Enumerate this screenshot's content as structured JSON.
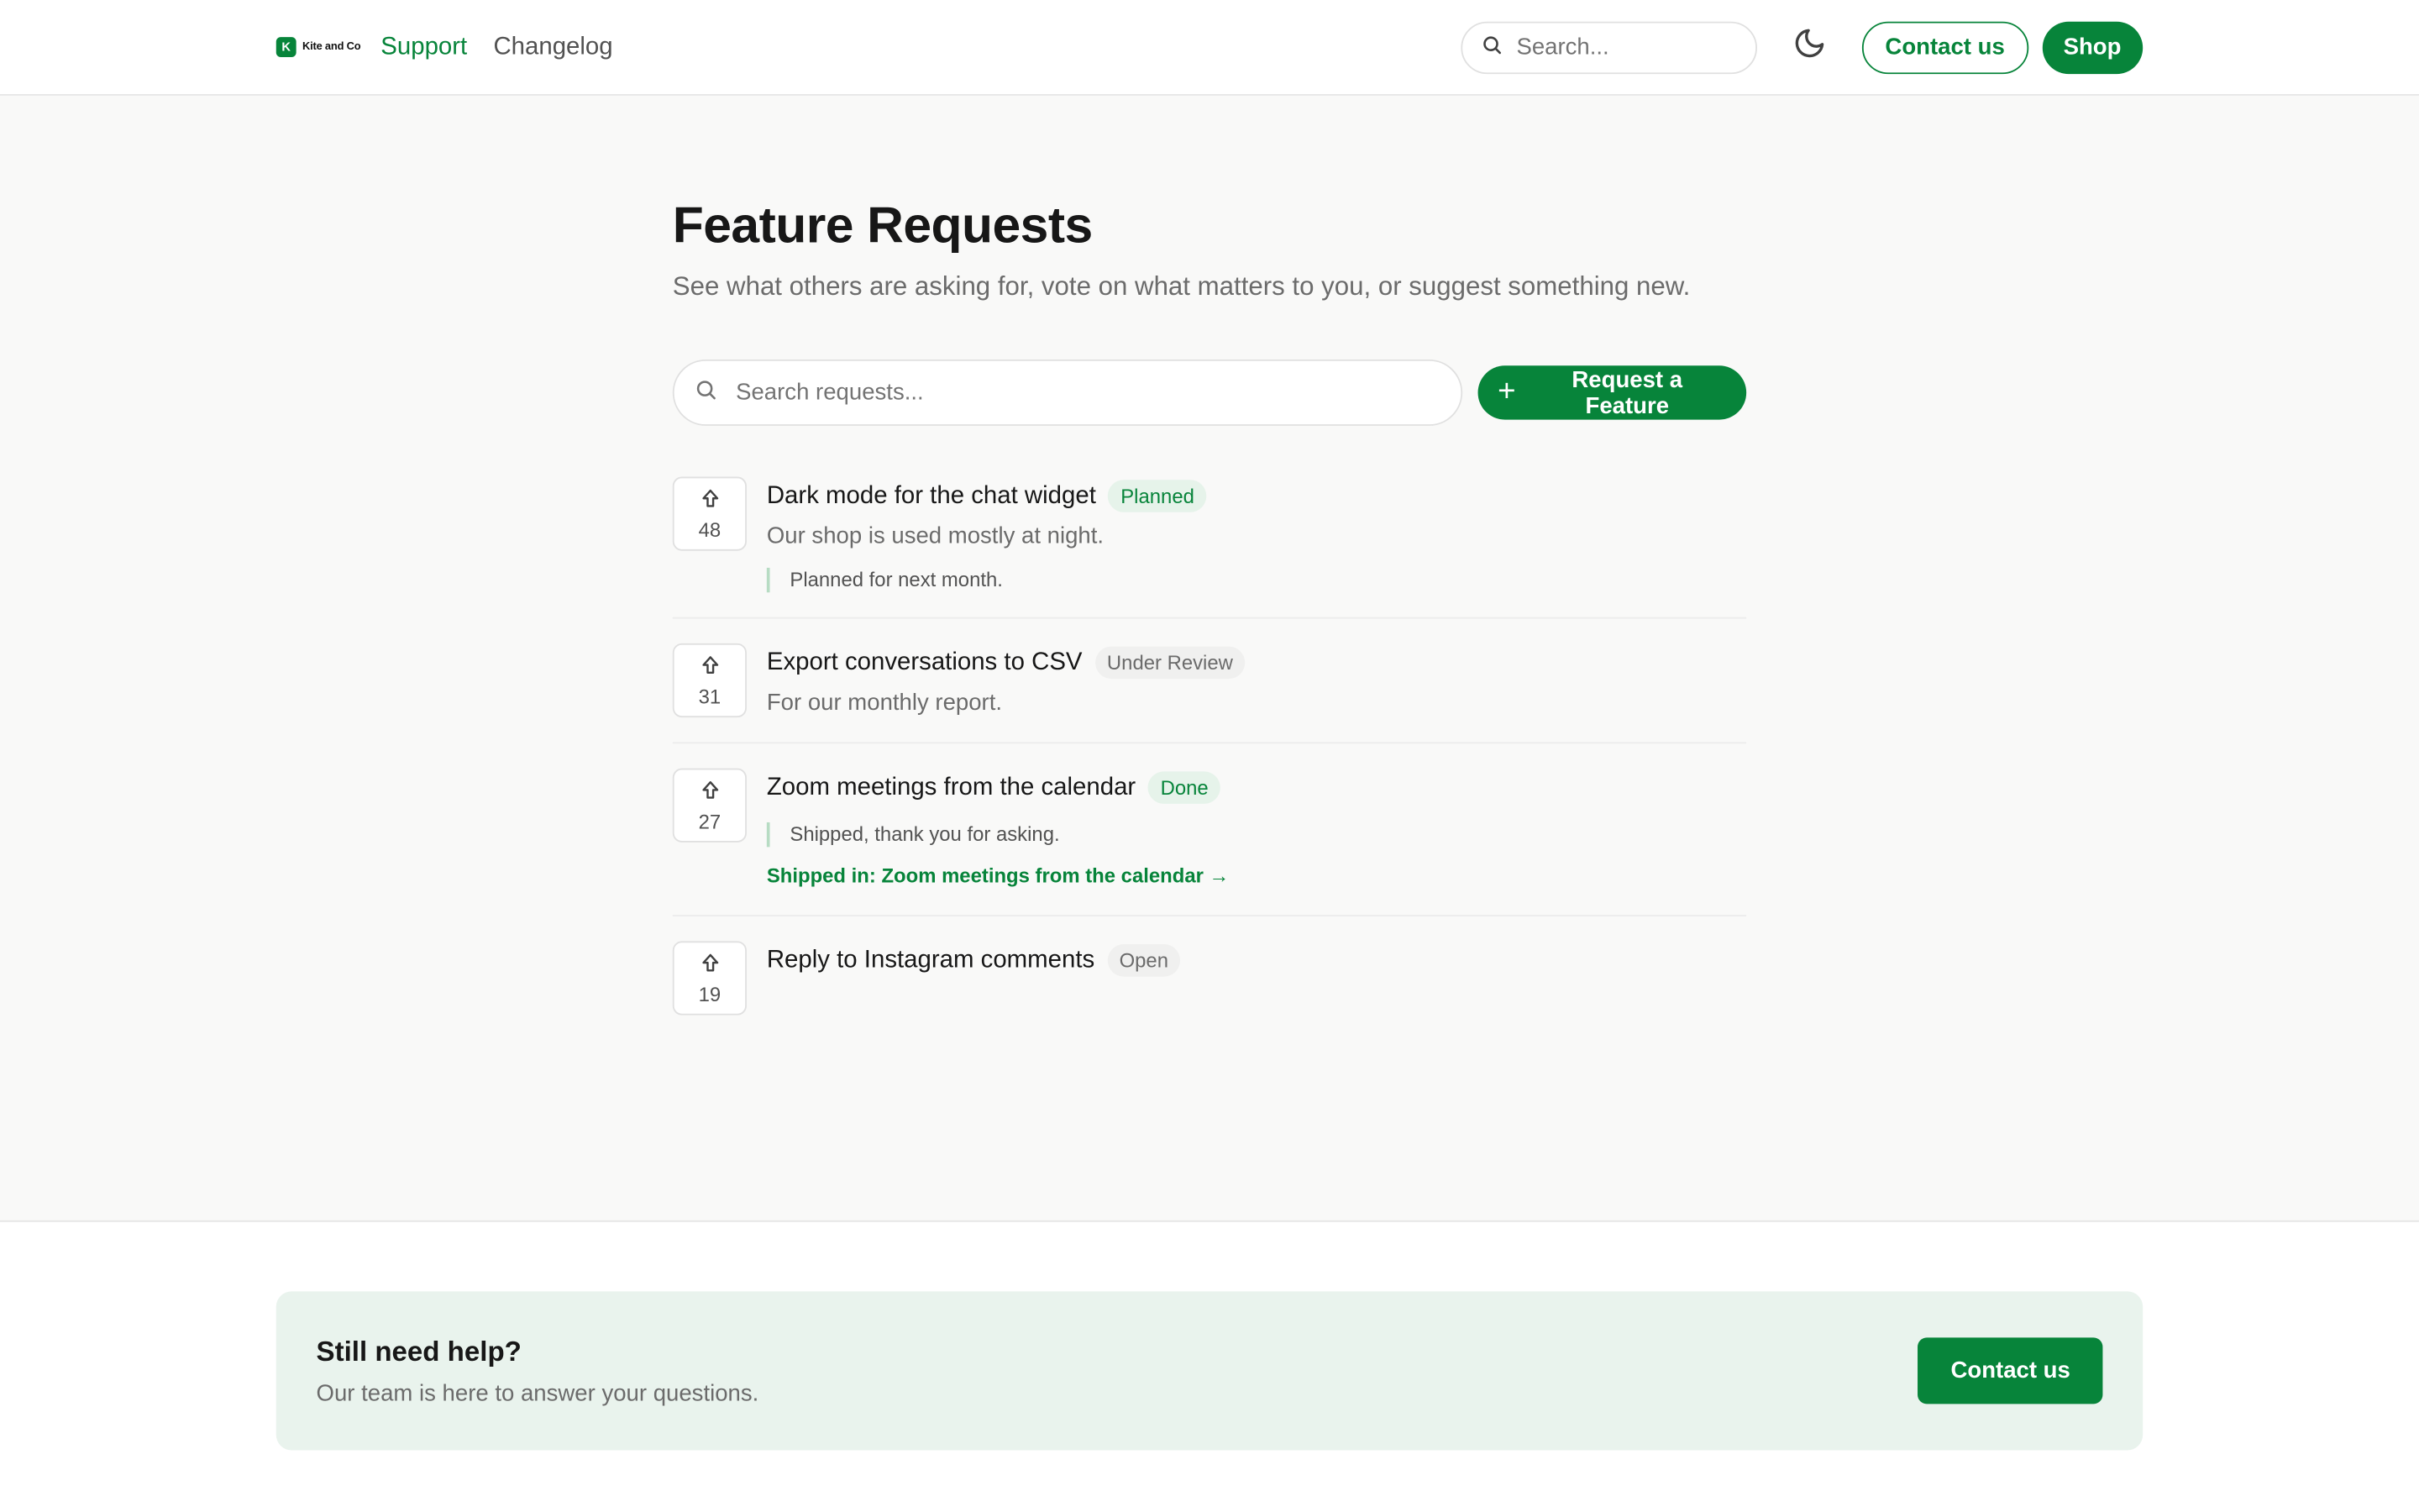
{
  "colors": {
    "accent": "#07843a",
    "accent_soft": "#e9f3ed"
  },
  "header": {
    "logo_mark": "K",
    "logo_text": "Kite and Co",
    "nav": [
      {
        "label": "Support",
        "active": true
      },
      {
        "label": "Changelog",
        "active": false
      }
    ],
    "search_placeholder": "Search...",
    "theme_icon": "moon-icon",
    "contact_label": "Contact us",
    "shop_label": "Shop"
  },
  "main": {
    "title": "Feature Requests",
    "subtitle": "See what others are asking for, vote on what matters to you, or suggest something new.",
    "search_placeholder": "Search requests...",
    "request_button_icon": "+",
    "request_button_label": "Request a Feature",
    "requests": [
      {
        "votes": "48",
        "title": "Dark mode for the chat widget",
        "status": "Planned",
        "description": "Our shop is used mostly at night.",
        "note": "Planned for next month."
      },
      {
        "votes": "31",
        "title": "Export conversations to CSV",
        "status": "Under Review",
        "description": "For our monthly report."
      },
      {
        "votes": "27",
        "title": "Zoom meetings from the calendar",
        "status": "Done",
        "note": "Shipped, thank you for asking.",
        "shipped_link": "Shipped in: Zoom meetings from the calendar →"
      },
      {
        "votes": "19",
        "title": "Reply to Instagram comments",
        "status": "Open"
      }
    ]
  },
  "help": {
    "title": "Still need help?",
    "subtitle": "Our team is here to answer your questions.",
    "button_label": "Contact us"
  }
}
